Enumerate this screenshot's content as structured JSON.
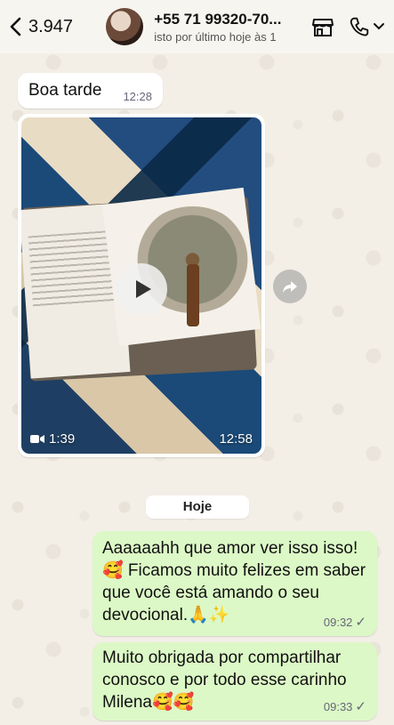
{
  "header": {
    "back_count": "3.947",
    "contact_name": "+55 71 99320-70...",
    "status": "isto por último hoje às 1",
    "icons": [
      "chevron-left-icon",
      "store-icon",
      "phone-icon",
      "chevron-down-icon"
    ]
  },
  "messages": [
    {
      "direction": "in",
      "text": "Boa tarde",
      "time": "12:28"
    },
    {
      "direction": "in",
      "type": "video",
      "duration": "1:39",
      "time": "12:58"
    }
  ],
  "day_separator": "Hoje",
  "outgoing": [
    {
      "text": "Aaaaaahh  que amor ver isso isso! 🥰 Ficamos muito felizes em saber que você está amando o seu devocional.🙏✨",
      "time": "09:32",
      "status": "✓"
    },
    {
      "text": "Muito obrigada por compartilhar conosco e por todo esse carinho Milena🥰🥰",
      "time": "09:33",
      "status": "✓"
    }
  ],
  "colors": {
    "incoming": "#ffffff",
    "outgoing": "#dcf8c6",
    "background": "#efeae2"
  }
}
